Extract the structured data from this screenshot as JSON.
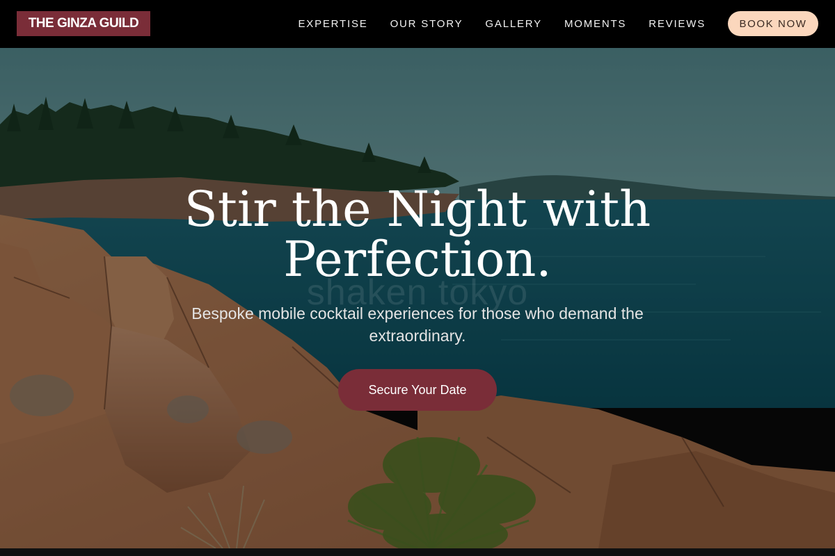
{
  "brand": {
    "name": "THE GINZA GUILD",
    "color": "#7a2d38"
  },
  "nav": {
    "links": [
      "EXPERTISE",
      "OUR STORY",
      "GALLERY",
      "MOMENTS",
      "REVIEWS"
    ],
    "cta_label": "BOOK NOW",
    "cta_color": "#fbd7bd"
  },
  "hero": {
    "headline_line1": "Stir the Night with",
    "headline_line2": "Perfection.",
    "ghost_text": "shaken tokyo",
    "subtitle": "Bespoke mobile cocktail experiences for those who demand the extraordinary.",
    "cta_label": "Secure Your Date",
    "background_image": "coastal-granite-rocks-sea-forest"
  }
}
